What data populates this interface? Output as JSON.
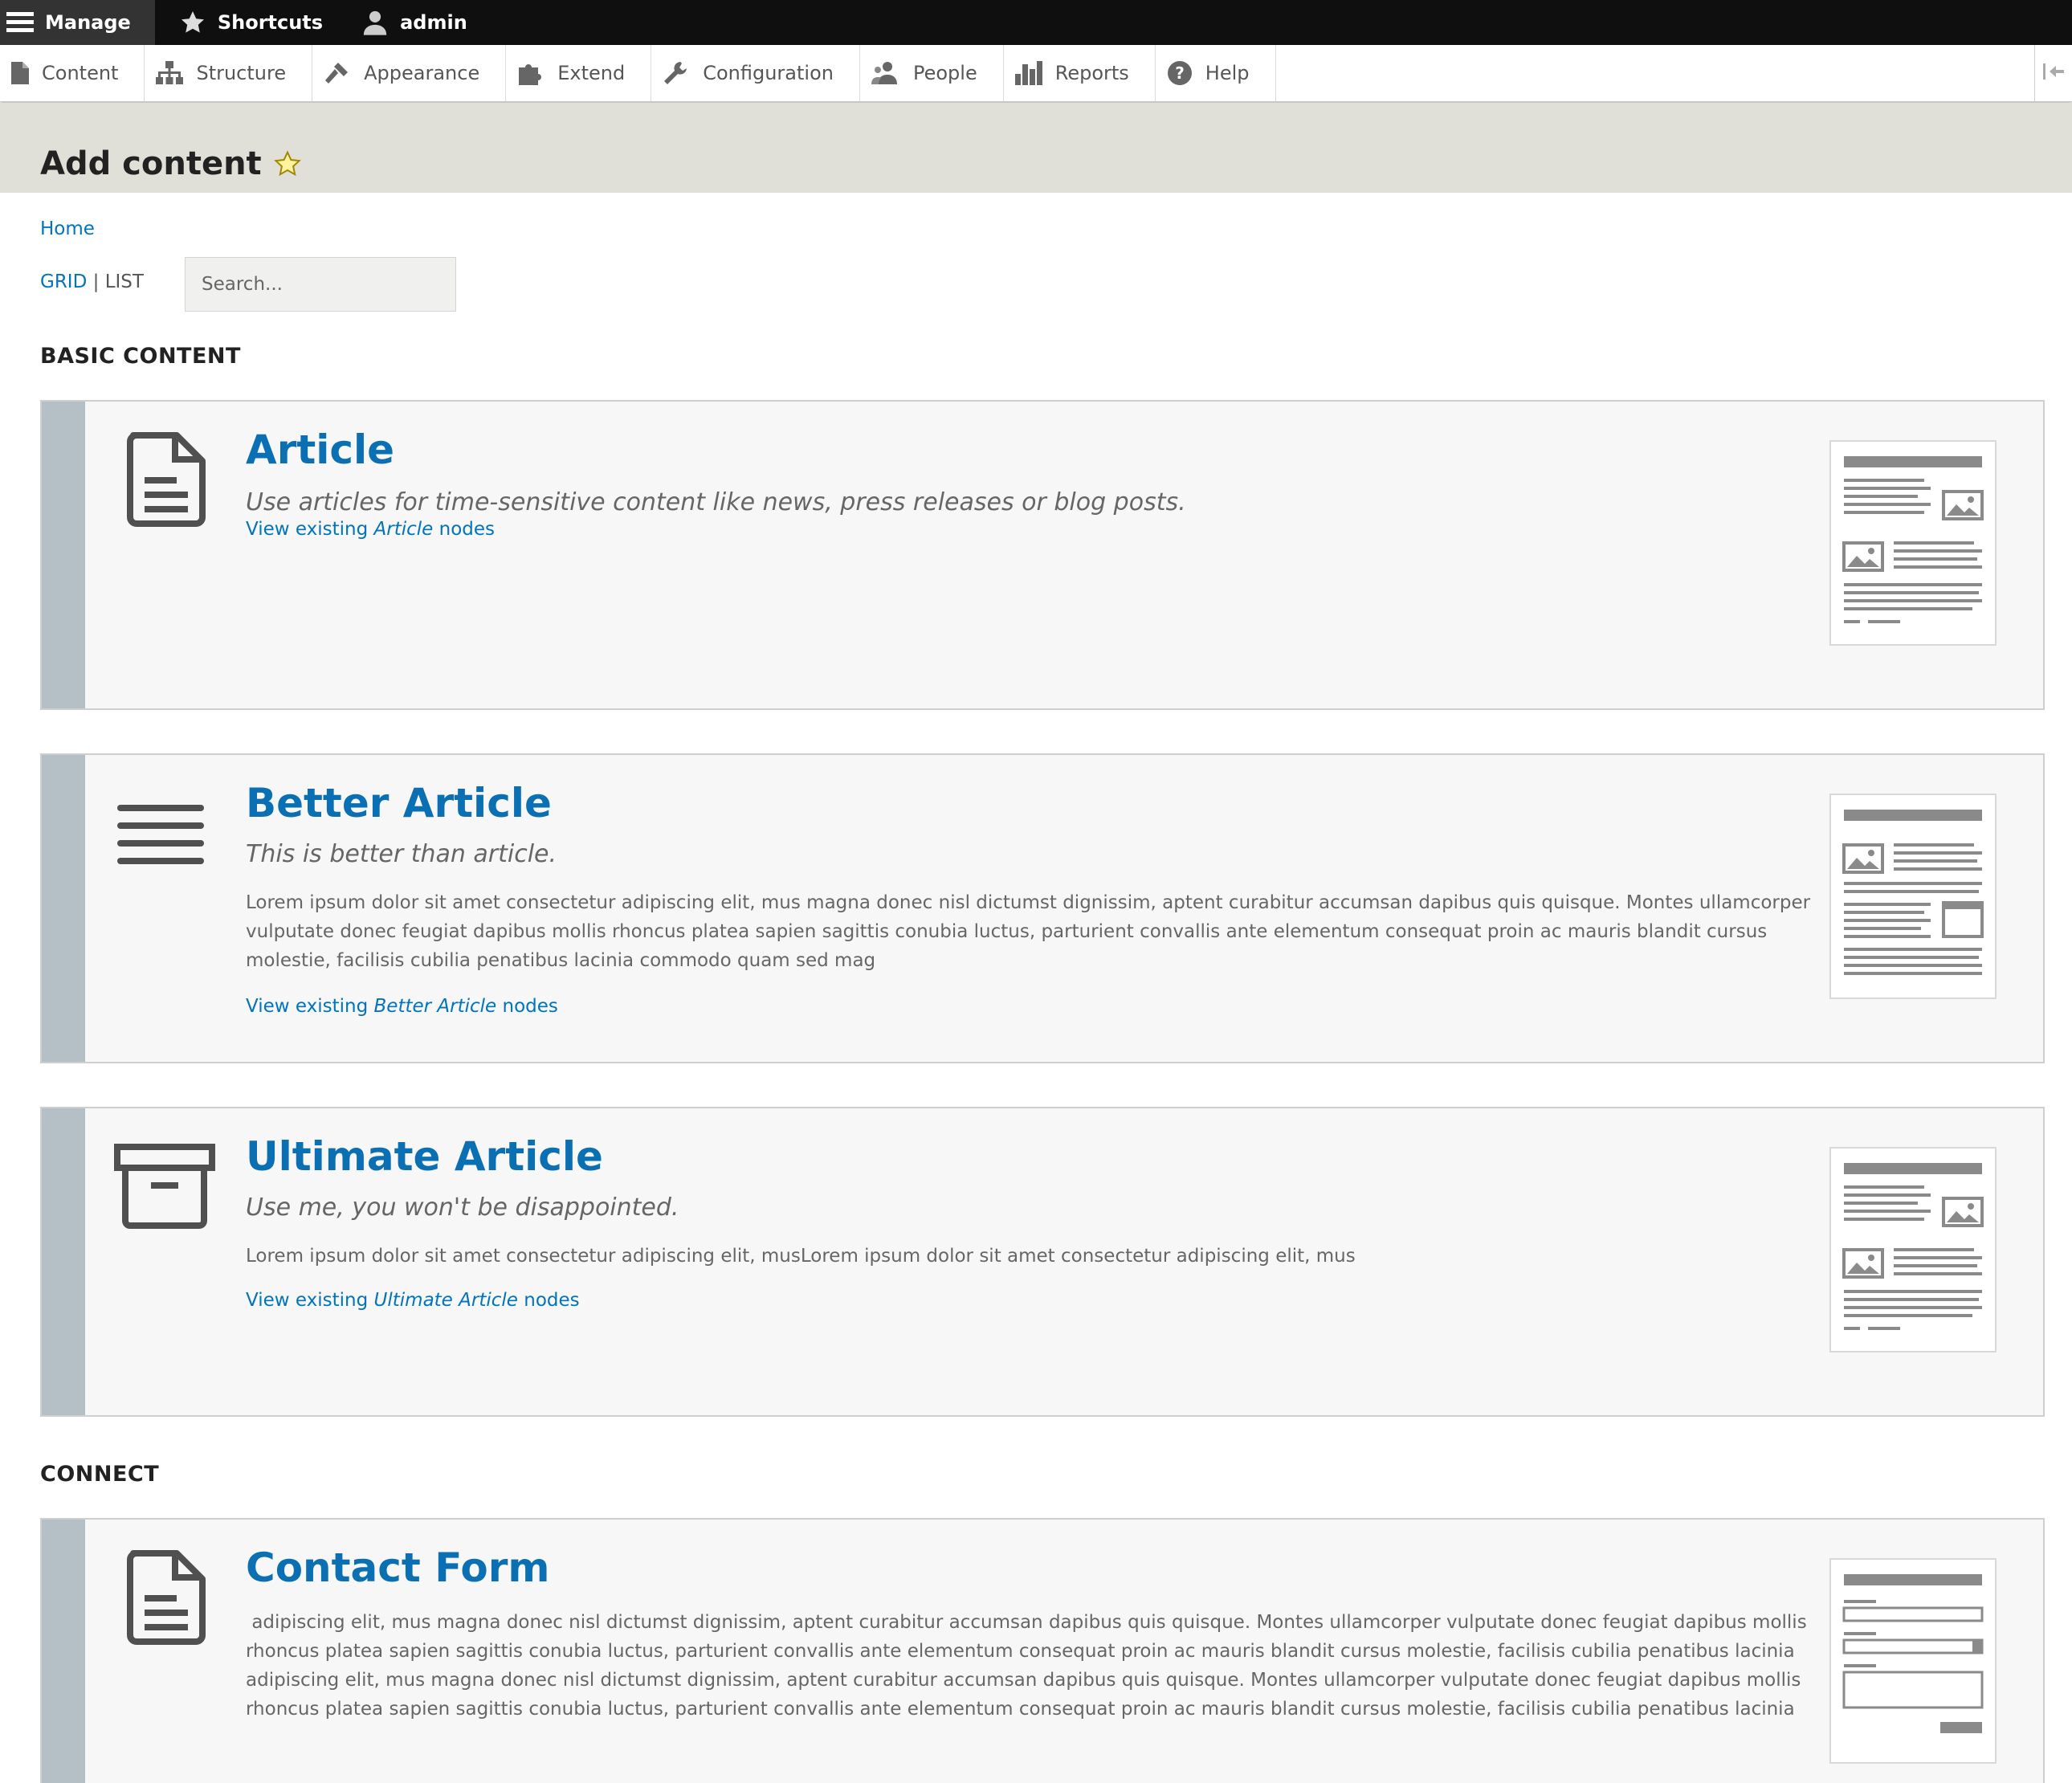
{
  "toolbar": {
    "manage_label": "Manage",
    "shortcuts_label": "Shortcuts",
    "user_label": "admin"
  },
  "tray": {
    "items": [
      {
        "label": "Content",
        "icon": "file-icon"
      },
      {
        "label": "Structure",
        "icon": "sitemap-icon"
      },
      {
        "label": "Appearance",
        "icon": "paintbrush-icon"
      },
      {
        "label": "Extend",
        "icon": "puzzle-icon"
      },
      {
        "label": "Configuration",
        "icon": "wrench-icon"
      },
      {
        "label": "People",
        "icon": "people-icon"
      },
      {
        "label": "Reports",
        "icon": "bar-chart-icon"
      },
      {
        "label": "Help",
        "icon": "help-icon"
      }
    ]
  },
  "page": {
    "title": "Add content",
    "breadcrumb": "Home",
    "view_grid": "GRID",
    "view_sep": "|",
    "view_list": "LIST",
    "search_placeholder": "Search..."
  },
  "sections": {
    "basic": "BASIC CONTENT",
    "connect": "CONNECT"
  },
  "cards": [
    {
      "title": "Article",
      "subtitle": "Use articles for time-sensitive content like news, press releases or blog posts.",
      "description": "",
      "link_prefix": "View existing",
      "link_type": "Article",
      "link_suffix": "nodes"
    },
    {
      "title": "Better Article",
      "subtitle": "This is better than article.",
      "description": "Lorem ipsum dolor sit amet consectetur adipiscing elit, mus magna donec nisl dictumst dignissim, aptent curabitur accumsan dapibus quis quisque. Montes ullamcorper vulputate donec feugiat dapibus mollis rhoncus platea sapien sagittis conubia luctus, parturient convallis ante elementum consequat proin ac mauris blandit cursus molestie, facilisis cubilia penatibus lacinia commodo quam sed mag",
      "link_prefix": "View existing",
      "link_type": "Better Article",
      "link_suffix": "nodes"
    },
    {
      "title": "Ultimate Article",
      "subtitle": "Use me, you won't be disappointed.",
      "description": "Lorem ipsum dolor sit amet consectetur adipiscing elit, musLorem ipsum dolor sit amet consectetur adipiscing elit, mus",
      "link_prefix": "View existing",
      "link_type": "Ultimate Article",
      "link_suffix": "nodes"
    },
    {
      "title": "Contact Form",
      "subtitle": "",
      "description": " adipiscing elit, mus magna donec nisl dictumst dignissim, aptent curabitur accumsan dapibus quis quisque. Montes ullamcorper vulputate donec feugiat dapibus mollis rhoncus platea sapien sagittis conubia luctus, parturient convallis ante elementum consequat proin ac mauris blandit cursus molestie, facilisis cubilia penatibus lacinia adipiscing elit, mus magna donec nisl dictumst dignissim, aptent curabitur accumsan dapibus quis quisque. Montes ullamcorper vulputate donec feugiat dapibus mollis rhoncus platea sapien sagittis conubia luctus, parturient convallis ante elementum consequat proin ac mauris blandit cursus molestie, facilisis cubilia penatibus lacinia",
      "link_prefix": "",
      "link_type": "",
      "link_suffix": ""
    }
  ],
  "colors": {
    "link": "#0074bd",
    "card_title": "#0a6fb3",
    "stripe": "#b4c0c5",
    "toolbar_bg": "#0f0f0f"
  }
}
